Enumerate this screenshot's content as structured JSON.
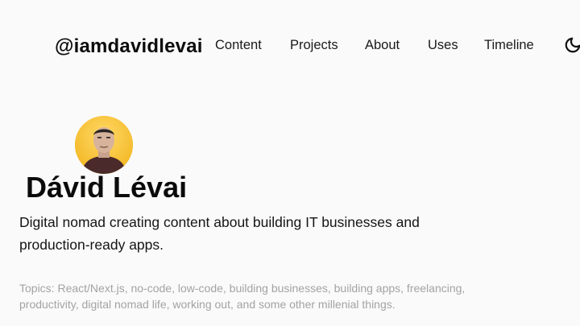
{
  "header": {
    "logo_text": "@iamdavidlevai",
    "nav": [
      {
        "label": "Content"
      },
      {
        "label": "Projects"
      },
      {
        "label": "About"
      },
      {
        "label": "Uses"
      },
      {
        "label": "Timeline"
      }
    ],
    "theme_icon": "moon-icon"
  },
  "hero": {
    "avatar_icon": "avatar-photo",
    "name": "Dávid Lévai",
    "tagline": "Digital nomad creating content about building IT businesses and production-ready apps.",
    "topics": "Topics: React/Next.js, no-code, low-code, building businesses, building apps, freelancing, productivity, digital nomad life, working out, and some other millenial things."
  },
  "colors": {
    "background": "#fafafa",
    "text": "#111111",
    "muted_text": "#a3a3a3",
    "avatar_background": "#f6c233"
  }
}
